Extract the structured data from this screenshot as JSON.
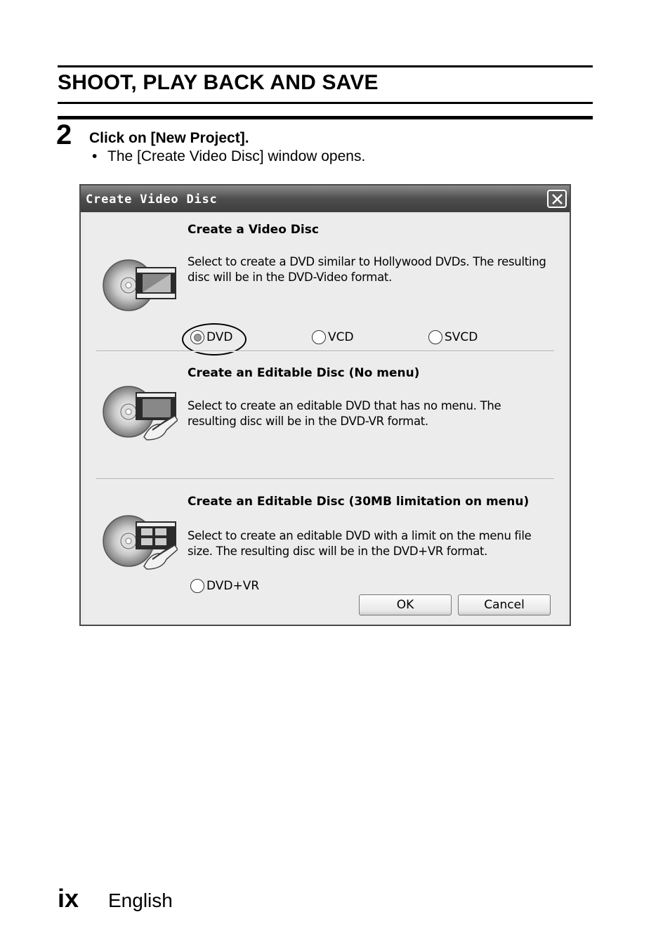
{
  "header": {
    "section_title": "SHOOT, PLAY BACK AND SAVE"
  },
  "step": {
    "number": "2",
    "instruction": "Click on [New Project].",
    "bullet": "•",
    "note": "The [Create Video Disc] window opens."
  },
  "dialog": {
    "title": "Create Video Disc",
    "options": [
      {
        "title": "Create a Video Disc",
        "description": "Select to create a DVD similar to Hollywood DVDs. The resulting disc will be in the DVD-Video format.",
        "radios": [
          {
            "label": "DVD",
            "checked": true
          },
          {
            "label": "VCD",
            "checked": false
          },
          {
            "label": "SVCD",
            "checked": false
          }
        ]
      },
      {
        "title": "Create an Editable Disc (No menu)",
        "description": "Select to create an editable DVD that has no menu. The resulting disc will be in the DVD-VR format."
      },
      {
        "title": "Create an Editable Disc (30MB limitation on menu)",
        "description": "Select to create an editable DVD with a limit on the menu file size. The resulting disc will be in the DVD+VR format.",
        "radios": [
          {
            "label": "DVD+VR",
            "checked": false
          }
        ]
      }
    ],
    "ok_label": "OK",
    "cancel_label": "Cancel"
  },
  "footer": {
    "page_number": "ix",
    "language": "English"
  }
}
